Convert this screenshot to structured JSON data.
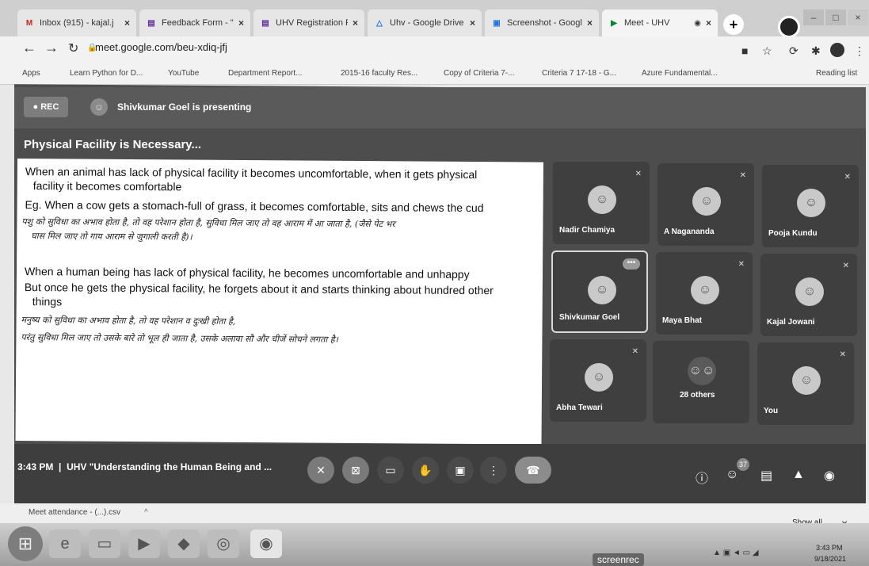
{
  "browser": {
    "tabs": [
      {
        "label": "Inbox (915) - kajal.j",
        "favicon": "M",
        "favicon_color": "#c5221f",
        "active": false
      },
      {
        "label": "Feedback Form - \"U",
        "favicon": "▤",
        "favicon_color": "#5b2ca0",
        "active": false
      },
      {
        "label": "UHV Registration Fo",
        "favicon": "▤",
        "favicon_color": "#5b2ca0",
        "active": false
      },
      {
        "label": "Uhv - Google Drive",
        "favicon": "△",
        "favicon_color": "#1a73e8",
        "active": false
      },
      {
        "label": "Screenshot - Googl",
        "favicon": "▣",
        "favicon_color": "#1a73e8",
        "active": false
      },
      {
        "label": "Meet - UHV",
        "favicon": "▶",
        "favicon_color": "#00832d",
        "active": true
      }
    ],
    "url": "meet.google.com/beu-xdiq-jfj",
    "bookmarks": [
      "Apps",
      "Learn Python for D...",
      "YouTube",
      "Department Report...",
      "2015-16 faculty Res...",
      "Copy of Criteria 7-...",
      "Criteria 7 17-18 - G...",
      "Azure Fundamental...",
      "Reading list"
    ]
  },
  "meet": {
    "rec_label": "REC",
    "presenting_text": "Shivkumar Goel is presenting",
    "slide": {
      "title": "Physical Facility is Necessary...",
      "lines": [
        "When an animal has lack of physical facility it becomes uncomfortable, when it gets physical",
        "facility it becomes comfortable",
        "Eg. When a cow gets a stomach-full of grass, it becomes comfortable, sits and chews the cud",
        "पशु को सुविधा का अभाव होता है, तो वह परेशान होता है, सुविधा मिल जाए तो वह आराम में आ जाता है, (जैसे पेट भर",
        "घास मिल जाए तो गाय आराम से जुगाली करती है)।",
        "When a human being has lack of physical facility, he becomes uncomfortable and unhappy",
        "But once he gets the physical facility, he forgets about it and starts thinking about hundred other",
        "things",
        "मनुष्य को सुविधा का अभाव होता है, तो वह परेशान व दुःखी होता है,",
        "परंतु सुविधा मिल जाए तो उसके बारे तो भूल ही जाता है, उसके अलावा सौ और चीजें सोचने लगता है।"
      ]
    },
    "participants": [
      {
        "name": "Nadir Chamiya"
      },
      {
        "name": "A Nagananda"
      },
      {
        "name": "Pooja Kundu"
      },
      {
        "name": "Shivkumar Goel"
      },
      {
        "name": "Maya Bhat"
      },
      {
        "name": "Kajal Jowani"
      },
      {
        "name": "Abha Tewari"
      },
      {
        "name": "28 others"
      },
      {
        "name": "You"
      }
    ],
    "time": "3:43 PM",
    "meeting_title": "UHV \"Understanding the Human Being and ...",
    "people_count": "37"
  },
  "download": {
    "file": "Meet attendance - (...).csv",
    "show_all": "Show all"
  },
  "taskbar": {
    "screenrec": "screenrec",
    "time": "3:43 PM",
    "date": "9/18/2021"
  }
}
